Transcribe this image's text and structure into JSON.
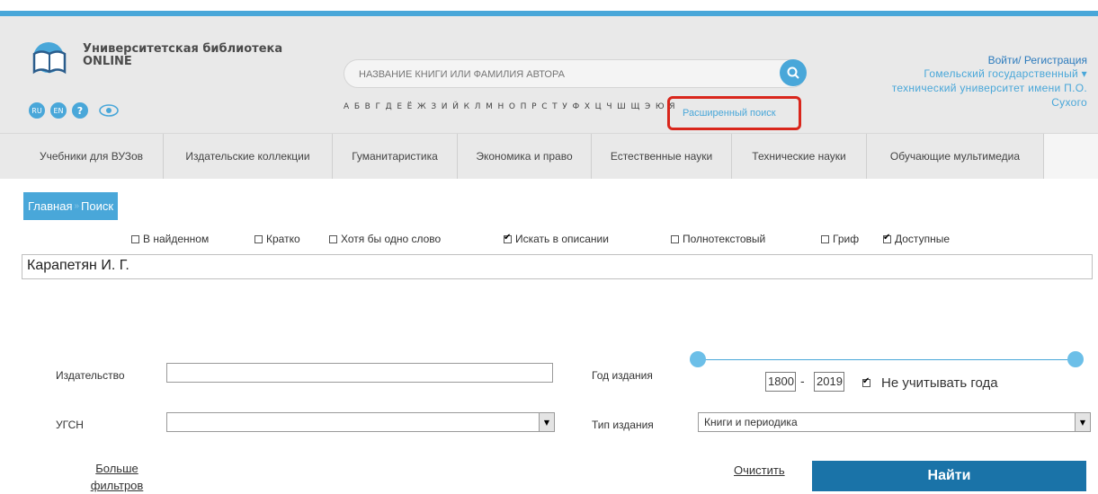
{
  "brand": {
    "line1": "Университетская библиотека",
    "line2": "ONLINE"
  },
  "langs": {
    "ru": "RU",
    "en": "EN",
    "help": "?"
  },
  "search": {
    "placeholder": "НАЗВАНИЕ КНИГИ ИЛИ ФАМИЛИЯ АВТОРА",
    "alphabet": "А Б В Г Д Е Ё Ж З И Й К Л М Н О П Р С Т У Ф Х Ц Ч Ш Щ Э Ю Я",
    "advanced": "Расширенный поиск"
  },
  "account": {
    "login": "Войти/ Регистрация",
    "org_line1": "Гомельский государственный ▾",
    "org_line2": "технический университет имени П.О.",
    "org_line3": "Сухого"
  },
  "nav": [
    "Учебники для ВУЗов",
    "Издательские коллекции",
    "Гуманитаристика",
    "Экономика и право",
    "Естественные науки",
    "Технические науки",
    "Обучающие мультимедиа"
  ],
  "breadcrumb": {
    "home": "Главная",
    "sep": "»",
    "current": "Поиск"
  },
  "options": [
    {
      "label": "В найденном",
      "checked": false
    },
    {
      "label": "Кратко",
      "checked": false
    },
    {
      "label": "Хотя бы одно слово",
      "checked": false
    },
    {
      "label": "Искать в описании",
      "checked": true
    },
    {
      "label": "Полнотекстовый",
      "checked": false
    },
    {
      "label": "Гриф",
      "checked": false
    },
    {
      "label": "Доступные",
      "checked": true
    }
  ],
  "query": "Карапетян И. Г.",
  "filters": {
    "publisher_label": "Издательство",
    "publisher_value": "",
    "ugsn_label": "УГСН",
    "ugsn_value": "",
    "year_label": "Год издания",
    "year_from": "1800",
    "year_to": "2019",
    "ignore_years_label": "Не учитывать года",
    "ignore_years_checked": true,
    "type_label": "Тип издания",
    "type_value": "Книги и периодика"
  },
  "actions": {
    "more_filters": "Больше фильтров",
    "clear": "Очистить",
    "find": "Найти"
  },
  "colors": {
    "accent": "#49a7d9",
    "find_button": "#1a73a8",
    "highlight": "#d9261c"
  }
}
